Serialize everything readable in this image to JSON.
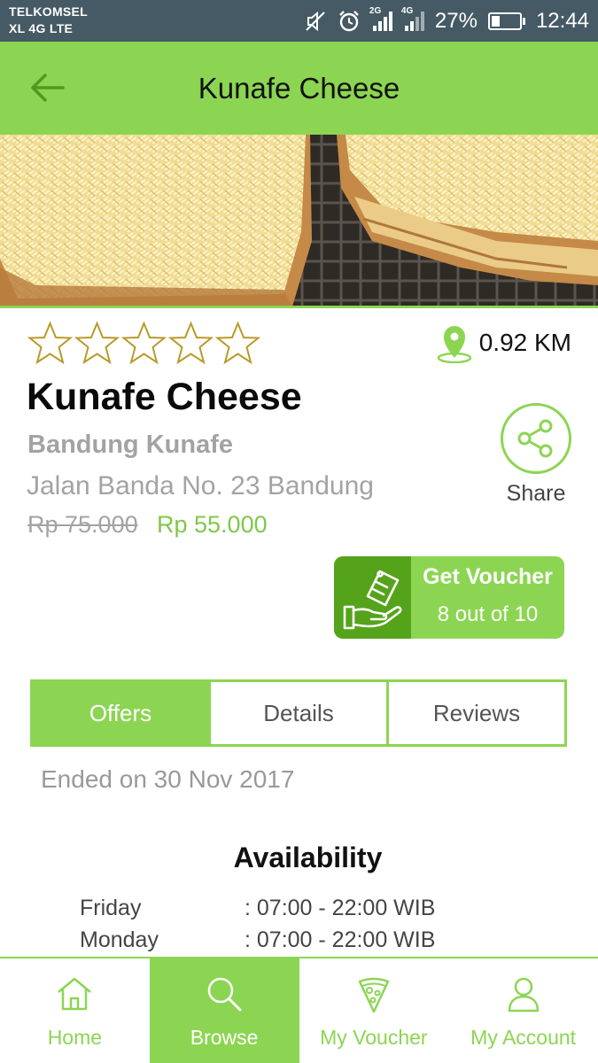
{
  "status_bar": {
    "carrier_1": "TELKOMSEL",
    "carrier_2": "XL 4G LTE",
    "net_1": "2G",
    "net_2": "4G",
    "battery": "27%",
    "time": "12:44"
  },
  "header": {
    "title": "Kunafe Cheese",
    "back_icon": "arrow-left-icon"
  },
  "product": {
    "rating": 0,
    "rating_max": 5,
    "distance": "0.92 KM",
    "name": "Kunafe Cheese",
    "brand": "Bandung Kunafe",
    "address": "Jalan Banda No. 23 Bandung",
    "price_old": "Rp 75.000",
    "price_new": "Rp 55.000"
  },
  "share": {
    "label": "Share",
    "icon": "share-icon"
  },
  "voucher": {
    "title": "Get Voucher",
    "count": "8 out of 10",
    "icon": "voucher-hand-icon"
  },
  "tabs": [
    {
      "label": "Offers",
      "active": true
    },
    {
      "label": "Details",
      "active": false
    },
    {
      "label": "Reviews",
      "active": false
    }
  ],
  "offer": {
    "status": "Ended on 30 Nov 2017"
  },
  "availability": {
    "title": "Availability",
    "rows": [
      {
        "day": "Friday",
        "hours": ": 07:00 - 22:00 WIB"
      },
      {
        "day": "Monday",
        "hours": ": 07:00 - 22:00 WIB"
      }
    ]
  },
  "bottom_nav": [
    {
      "label": "Home",
      "icon": "home-icon",
      "active": false
    },
    {
      "label": "Browse",
      "icon": "search-icon",
      "active": true
    },
    {
      "label": "My Voucher",
      "icon": "pizza-slice-icon",
      "active": false
    },
    {
      "label": "My Account",
      "icon": "user-icon",
      "active": false
    }
  ],
  "colors": {
    "accent": "#8cd552",
    "accent_dark": "#55a31b",
    "status_bar": "#455a64",
    "muted_text": "#a3a3a3"
  }
}
